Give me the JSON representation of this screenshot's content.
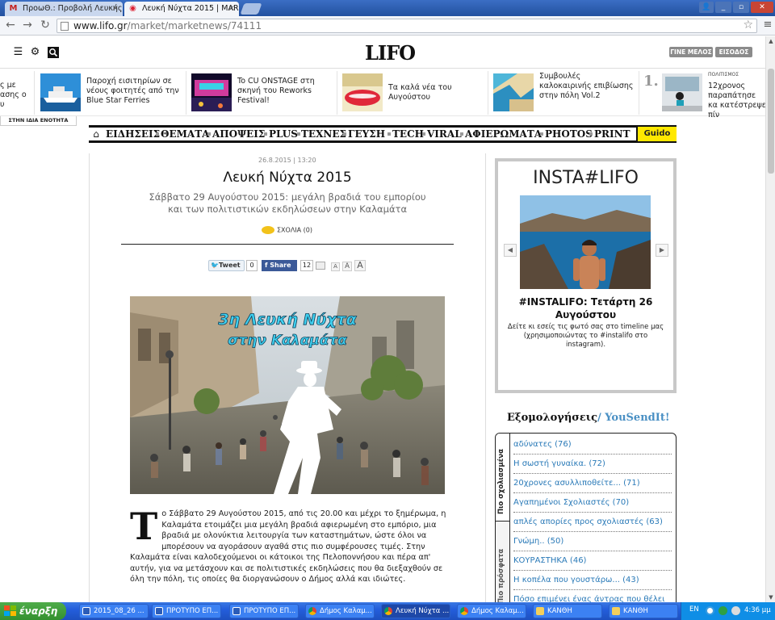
{
  "browser": {
    "tabs": [
      {
        "label": "ΠροωΘ.: Προβολή Λευκής Ν",
        "icon": "gmail-icon",
        "active": false
      },
      {
        "label": "Λευκή Νύχτα 2015 | MARKE",
        "icon": "lifo-favicon",
        "active": true
      }
    ],
    "url_host": "www.lifo.gr",
    "url_path": "/market/marketnews/74111"
  },
  "site": {
    "logo": "LIFO",
    "join_label": "ΓΙΝΕ ΜΕΛΟΣ",
    "login_label": "ΕΙΣΟΔΟΣ"
  },
  "related": {
    "partial_text": "ς με\nασης ο\nυ",
    "section_tag": "ΣΤΗΝ ΙΔΙΑ ΕΝΟΤΗΤΑ",
    "items": [
      {
        "text": "Παροχή εισιτηρίων σε νέους φοιτητές από την Blue Star Ferries"
      },
      {
        "text": "To CU ONSTAGE στη σκηνή του Reworks Festival!"
      },
      {
        "text": "Τα καλά νέα του Αυγούστου"
      },
      {
        "text": "Συμβουλές καλοκαιρινής επιβίωσης στην πόλη Vol.2"
      }
    ],
    "popular": {
      "rank": "1.",
      "category": "ΠΟΛΙΤΙΣΜΟΣ",
      "text": "12χρονος παραπάτησε κα κατέστρεψε πίν"
    }
  },
  "nav": {
    "items": [
      "ΕΙΔΗΣΕΙΣ",
      "ΘΕΜΑΤΑ",
      "ΑΠΟΨΕΙΣ",
      "PLUS",
      "ΤΕΧΝΕΣ",
      "ΓΕΥΣΗ",
      "TECH",
      "VIRAL",
      "ΑΦΙΕΡΩΜΑΤΑ",
      "PHOTOS",
      "PRINT"
    ],
    "guide": "Guido"
  },
  "article": {
    "date": "26.8.2015 | 13:20",
    "title": "Λευκή Νύχτα 2015",
    "subtitle": "Σάββατο 29 Αυγούστου 2015: μεγάλη βραδιά του εμπορίου και των πολιτιστικών εκδηλώσεων στην Καλαμάτα",
    "comments": "ΣΧΟΛΙΑ (0)",
    "tweet_label": "Tweet",
    "tweet_count": "0",
    "share_label": "Share",
    "share_count": "12",
    "font_small": "A",
    "font_medium": "A",
    "font_large": "A",
    "hero_line1": "3η Λευκή Νύχτα",
    "hero_line2": "στην Καλαμάτα",
    "dropcap": "T",
    "body": "ο Σάββατο 29 Αυγούστου 2015, από τις 20.00 και μέχρι το ξημέρωμα, η Καλαμάτα ετοιμάζει μια μεγάλη βραδιά αφιερωμένη στο εμπόριο, μια βραδιά με ολονύκτια λειτουργία των καταστημάτων, ώστε όλοι να μπορέσουν να αγοράσουν αγαθά στις πιο συμφέρουσες τιμές. Στην Καλαμάτα είναι καλοδεχούμενοι οι κάτοικοι της Πελοποννήσου και πέρα απ' αυτήν, για να μετάσχουν και σε πολιτιστικές εκδηλώσεις που θα διεξαχθούν σε όλη την πόλη, τις οποίες θα διοργανώσουν ο Δήμος αλλά και ιδιώτες."
  },
  "insta": {
    "title": "INSTA#LIFO",
    "caption": "#INSTALIFO: Τετάρτη 26 Αυγούστου",
    "desc": "Δείτε κι εσείς τις φωτό σας στο timeline μας (χρησιμοποιώντας το #instalifo στο instagram)."
  },
  "confessions": {
    "title_a": "Εξομολογήσεις",
    "title_b": "/ YouSendIt!",
    "tab_popular": "Πιο σχολιασμένα",
    "tab_recent": "Πιο πρόσφατα",
    "items": [
      "αδύνατες (76)",
      "Η σωστή γυναίκα. (72)",
      "20χρονες ασυλλιποθείτε... (71)",
      "Αγαπημένοι Σχολιαστές (70)",
      "απλές απορίες προς σχολιαστές (63)",
      "Γνώμη.. (50)",
      "ΚΟΥΡΑΣΤΗΚΑ (46)",
      "Η κοπέλα που γουστάρω... (43)",
      "Πόσο επιμένει ένας άντρας που θέλει"
    ]
  },
  "taskbar": {
    "start": "έναρξη",
    "tasks": [
      {
        "label": "2015_08_26 ...",
        "icon": "word-icon"
      },
      {
        "label": "ΠΡΟΤΥΠΟ ΕΠ...",
        "icon": "word-icon"
      },
      {
        "label": "ΠΡΟΤΥΠΟ ΕΠ...",
        "icon": "word-icon"
      },
      {
        "label": "Δήμος Καλαμ...",
        "icon": "chrome-icon"
      },
      {
        "label": "Λευκή Νύχτα ...",
        "icon": "chrome-icon"
      },
      {
        "label": "Δήμος Καλαμ...",
        "icon": "chrome-icon"
      },
      {
        "label": "ΚΑΝΘΗ",
        "icon": "folder-icon"
      },
      {
        "label": "ΚΑΝΘΗ",
        "icon": "folder-icon"
      }
    ],
    "lang": "EN",
    "clock": "4:36 μμ"
  },
  "colors": {
    "xp_blue": "#245edb",
    "guide_yellow": "#ffe800",
    "link_blue": "#2a7ab8",
    "fb_blue": "#3b5998"
  }
}
